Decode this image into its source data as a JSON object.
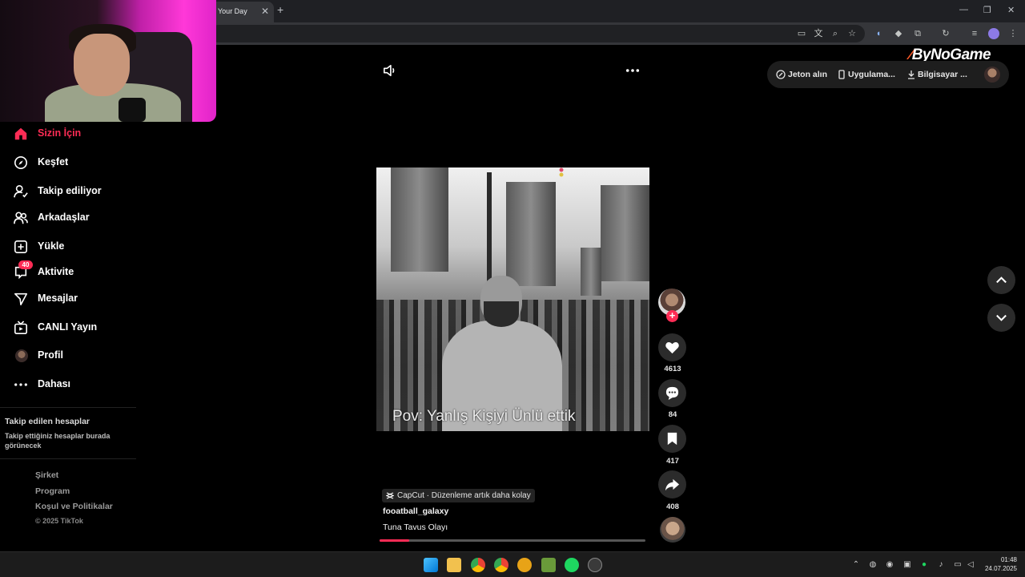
{
  "browser": {
    "tab_title": "Your Day",
    "tab_close": "✕",
    "new_tab": "+",
    "window_controls": [
      "—",
      "❐",
      "✕"
    ]
  },
  "sidebar": {
    "items": [
      {
        "label": "Sizin İçin",
        "icon": "home-icon",
        "active": true
      },
      {
        "label": "Keşfet",
        "icon": "compass-icon"
      },
      {
        "label": "Takip ediliyor",
        "icon": "following-icon"
      },
      {
        "label": "Arkadaşlar",
        "icon": "friends-icon"
      },
      {
        "label": "Yükle",
        "icon": "upload-icon"
      },
      {
        "label": "Aktivite",
        "icon": "activity-icon",
        "badge": "40"
      },
      {
        "label": "Mesajlar",
        "icon": "messages-icon"
      },
      {
        "label": "CANLI Yayın",
        "icon": "live-icon"
      },
      {
        "label": "Profil",
        "icon": "profile-avatar"
      },
      {
        "label": "Dahası",
        "icon": "more-icon"
      }
    ],
    "following_title": "Takip edilen hesaplar",
    "following_sub": "Takip ettiğiniz hesaplar burada görünecek",
    "footer": {
      "links": [
        "Şirket",
        "Program",
        "Koşul ve Politikalar"
      ],
      "copyright": "© 2025 TikTok"
    }
  },
  "header": {
    "coins": "Jeton alın",
    "app": "Uygulama...",
    "pc": "Bilgisayar ..."
  },
  "logo": {
    "text": "ByNoGame"
  },
  "video": {
    "caption": "Pov: Yanlış Kişiyi Ünlü ettik",
    "likes": "4613",
    "comments": "84",
    "saves": "417",
    "shares": "408",
    "follow": "+",
    "capcut": "CapCut · Düzenleme artık daha kolay",
    "author": "fooatball_galaxy",
    "description": "Tuna Tavus Olayı",
    "progress": 0.11
  },
  "colors": {
    "accent": "#fe2c55"
  },
  "taskbar": {
    "time": "01:48",
    "date": "24.07.2025"
  }
}
